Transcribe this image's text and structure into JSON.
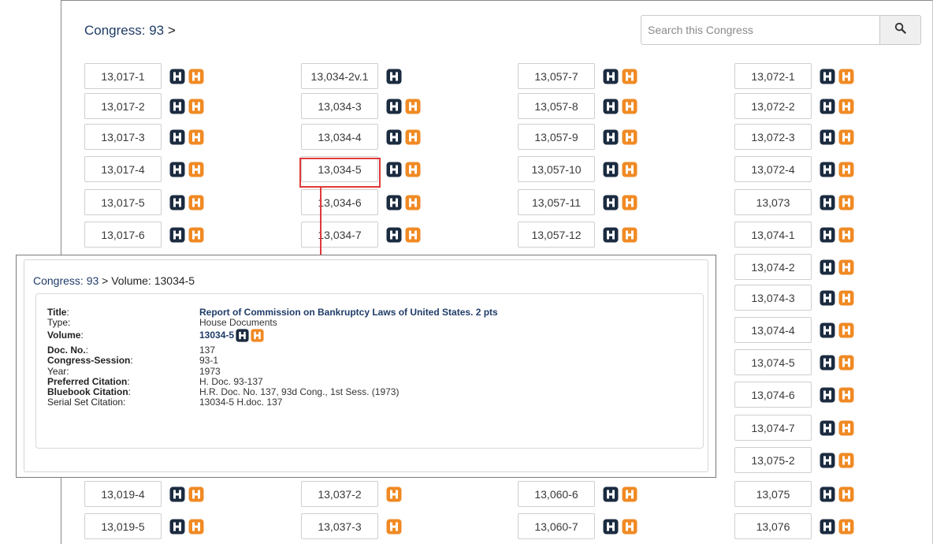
{
  "breadcrumb": {
    "congress": "Congress: 93",
    "sep": " >"
  },
  "search": {
    "placeholder": "Search this Congress"
  },
  "volumes": [
    [
      "13,017-1",
      "13,034-2v.1",
      "13,057-7",
      "13,072-1"
    ],
    [
      "13,017-2",
      "13,034-3",
      "13,057-8",
      "13,072-2"
    ],
    [
      "13,017-3",
      "13,034-4",
      "13,057-9",
      "13,072-3"
    ],
    [
      "13,017-4",
      "13,034-5",
      "13,057-10",
      "13,072-4"
    ],
    [
      "13,017-5",
      "13,034-6",
      "13,057-11",
      "13,073"
    ],
    [
      "13,017-6",
      "13,034-7",
      "13,057-12",
      "13,074-1"
    ],
    [
      null,
      null,
      null,
      "13,074-2"
    ],
    [
      null,
      null,
      null,
      "13,074-3"
    ],
    [
      null,
      null,
      null,
      "13,074-4"
    ],
    [
      null,
      null,
      null,
      "13,074-5"
    ],
    [
      null,
      null,
      null,
      "13,074-6"
    ],
    [
      null,
      null,
      null,
      "13,074-7"
    ],
    [
      null,
      null,
      null,
      "13,075-2"
    ],
    [
      "13,019-4",
      "13,037-2",
      "13,060-6",
      "13,075"
    ],
    [
      "13,019-5",
      "13,037-3",
      "13,060-7",
      "13,076"
    ]
  ],
  "icon_kinds": {
    "13,034-2v.1": "dark-only",
    "13,037-2": "orange-only",
    "13,037-3": "orange-only"
  },
  "colors": {
    "dark_icon": "#1b2b40",
    "orange_icon": "#f08a24",
    "highlight": "#e0393a",
    "link": "#1f3c68"
  },
  "popup": {
    "breadcrumb_congress": "Congress: 93",
    "breadcrumb_rest": " > Volume: 13034-5",
    "fields": [
      {
        "key": "Title",
        "value": "Report of Commission on Bankruptcy Laws of United States. 2 pts",
        "style": "link",
        "key_bold": true
      },
      {
        "key": "Type",
        "value": "House Documents",
        "style": "plain",
        "key_bold": false
      },
      {
        "key": "Volume",
        "value": "13034-5",
        "style": "volume",
        "key_bold": true
      },
      {
        "key": "Doc. No.",
        "value": "137",
        "style": "plain",
        "key_bold": true
      },
      {
        "key": "Congress-Session",
        "value": "93-1",
        "style": "plain",
        "key_bold": true
      },
      {
        "key": "Year",
        "value": "1973",
        "style": "plain",
        "key_bold": false
      },
      {
        "key": "Preferred Citation",
        "value": "H. Doc. 93-137",
        "style": "plain",
        "key_bold": true
      },
      {
        "key": "Bluebook Citation",
        "value": "H.R. Doc. No. 137, 93d Cong., 1st Sess. (1973)",
        "style": "plain",
        "key_bold": true
      },
      {
        "key": "Serial Set Citation",
        "value": "13034-5 H.doc. 137",
        "style": "plain",
        "key_bold": false
      }
    ]
  }
}
